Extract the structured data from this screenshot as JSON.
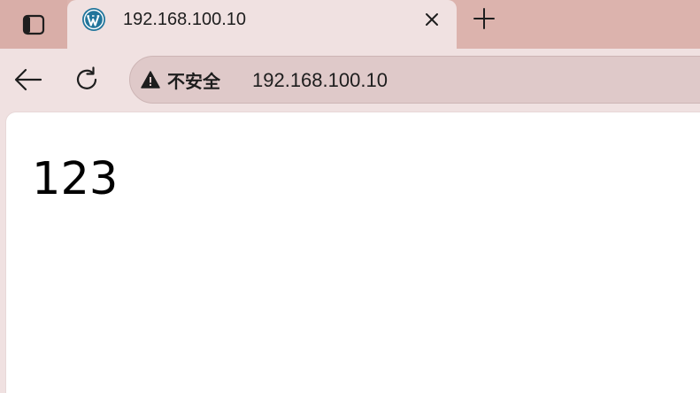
{
  "tab": {
    "title": "192.168.100.10",
    "favicon": "wordpress-icon",
    "close_icon": "close-icon"
  },
  "toolbar": {
    "back_icon": "back-arrow-icon",
    "reload_icon": "reload-icon",
    "new_tab_icon": "plus-icon",
    "tab_actions_icon": "tab-actions-icon"
  },
  "address_bar": {
    "security_icon": "warning-icon",
    "security_label": "不安全",
    "url": "192.168.100.10"
  },
  "page": {
    "body_text": "123"
  },
  "colors": {
    "tabstrip": "#dcb3ad",
    "toolbar": "#f0e1e1",
    "omnibox": "#dfc9c9",
    "wordpress_blue": "#21759b",
    "page_background": "#ffffff"
  }
}
